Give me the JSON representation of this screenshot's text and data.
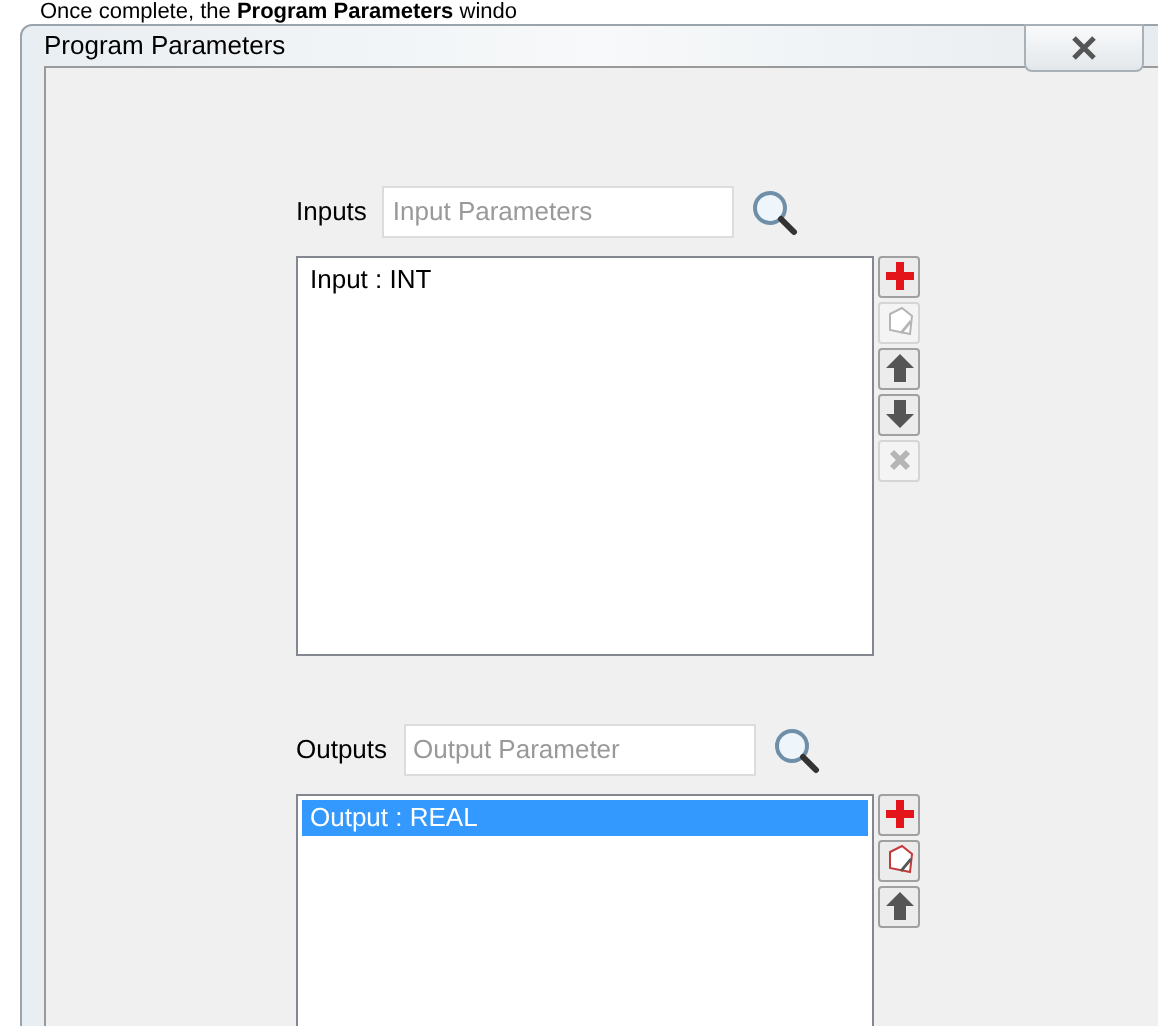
{
  "document_text": "Once complete, the **Program Parameters** windo",
  "window": {
    "title": "Program Parameters"
  },
  "sections": [
    {
      "label": "Inputs",
      "placeholder": "Input Parameters",
      "items": [
        {
          "text": "Input : INT",
          "selected": false
        }
      ],
      "buttons": [
        {
          "kind": "add",
          "disabled": false
        },
        {
          "kind": "edit",
          "disabled": true
        },
        {
          "kind": "up",
          "disabled": false
        },
        {
          "kind": "down",
          "disabled": false
        },
        {
          "kind": "delete",
          "disabled": true
        }
      ]
    },
    {
      "label": "Outputs",
      "placeholder": "Output Parameter",
      "items": [
        {
          "text": "Output : REAL",
          "selected": true
        }
      ],
      "buttons": [
        {
          "kind": "add",
          "disabled": false
        },
        {
          "kind": "edit",
          "disabled": false
        },
        {
          "kind": "up",
          "disabled": false
        }
      ]
    }
  ]
}
